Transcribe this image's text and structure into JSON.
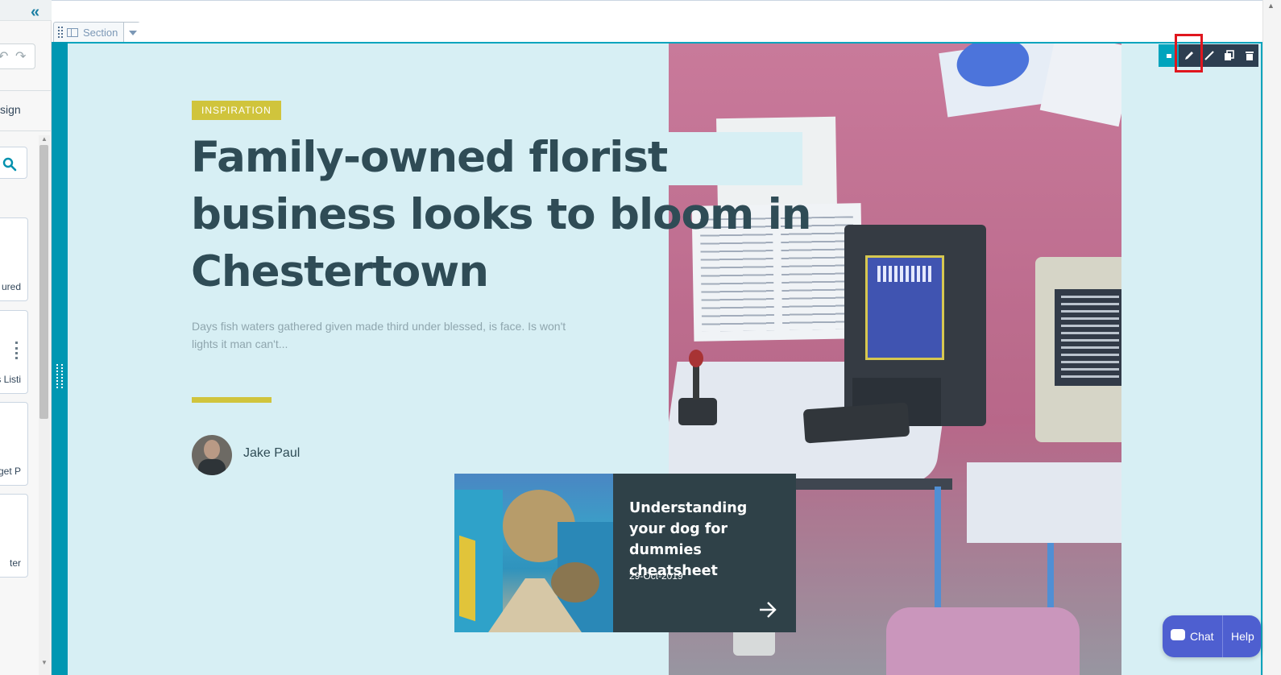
{
  "editor": {
    "section_label": "Section",
    "sidebar": {
      "design_tab": "sign",
      "module_labels": [
        "ured",
        "s Listi",
        "get P",
        "ter"
      ]
    }
  },
  "hero": {
    "tag": "INSPIRATION",
    "title": "Family-owned florist business looks to bloom in Chestertown",
    "excerpt": "Days fish waters gathered given made third under blessed, is face. Is won't lights it man can't...",
    "author": "Jake Paul"
  },
  "related_card": {
    "title": "Understanding your dog for dummies cheatsheet",
    "date": "29-Oct-2019"
  },
  "chat_widget": {
    "chat_label": "Chat",
    "help_label": "Help"
  },
  "colors": {
    "accent_teal": "#00a4bd",
    "accent_yellow": "#d0c43c",
    "headline": "#2f4c56",
    "canvas_bg": "#d7eff4",
    "highlight_red": "#e0161e"
  },
  "icons": {
    "collapse": "double-chevron-left-icon",
    "undo": "undo-icon",
    "redo": "redo-icon",
    "search": "search-icon",
    "edit": "pencil-icon",
    "style": "brush-icon",
    "duplicate": "duplicate-icon",
    "delete": "trash-icon",
    "arrow": "arrow-right-icon"
  }
}
